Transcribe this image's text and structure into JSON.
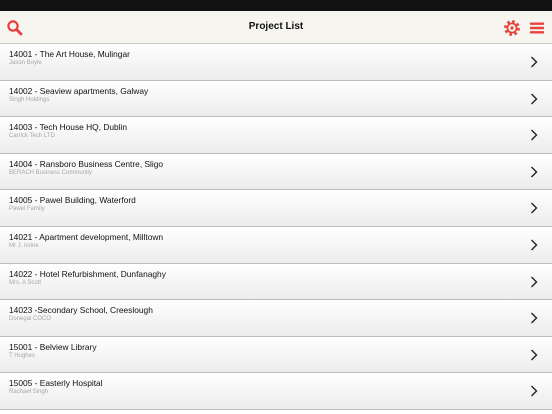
{
  "header": {
    "title": "Project List",
    "icons": {
      "search": "search-icon",
      "settings": "gear-icon",
      "menu": "hamburger-menu-icon"
    },
    "accent_color": "#e8403a"
  },
  "projects": [
    {
      "title": "14001 - The Art House, Mulingar",
      "client": "Jason Boyle"
    },
    {
      "title": "14002 - Seaview apartments, Galway",
      "client": "Singh Holdings"
    },
    {
      "title": "14003 - Tech House HQ, Dublin",
      "client": "Carrick Tech LTD"
    },
    {
      "title": "14004 - Ransboro Business Centre, Sligo",
      "client": "BERACH Business Community"
    },
    {
      "title": "14005 - Pawel Building, Waterford",
      "client": "Pawel Family"
    },
    {
      "title": "14021 - Apartment development, Milltown",
      "client": "Mr J. Irvine"
    },
    {
      "title": "14022 - Hotel Refurbishment, Dunfanaghy",
      "client": "Mrs. A Scott"
    },
    {
      "title": "14023 -Secondary School, Creeslough",
      "client": "Donegal COCO"
    },
    {
      "title": "15001 - Belview Library",
      "client": "T Hughes"
    },
    {
      "title": "15005 - Easterly Hospital",
      "client": "Rachael Singh"
    }
  ]
}
